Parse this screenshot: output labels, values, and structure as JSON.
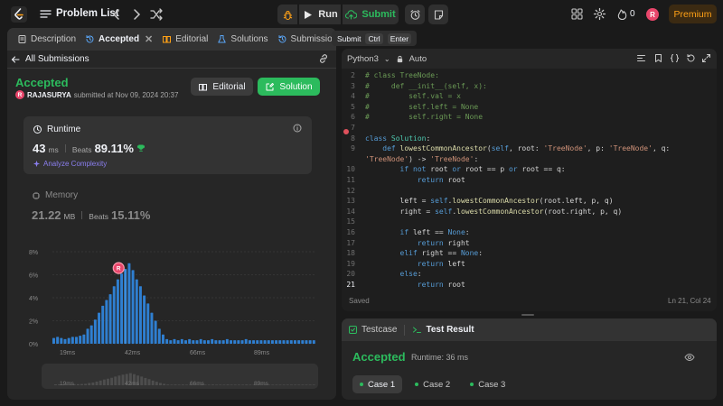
{
  "topbar": {
    "problem_list": "Problem List",
    "run": "Run",
    "submit": "Submit",
    "fire_count": "0",
    "avatar_initial": "R",
    "premium": "Premium"
  },
  "tooltip": {
    "label": "Submit",
    "key1": "Ctrl",
    "key2": "Enter"
  },
  "left_tabs": [
    {
      "label": "Description"
    },
    {
      "label": "Accepted"
    },
    {
      "label": "Editorial"
    },
    {
      "label": "Solutions"
    },
    {
      "label": "Submissions"
    }
  ],
  "submission": {
    "back_label": "All Submissions",
    "status": "Accepted",
    "avatar_initial": "R",
    "user": "RAJASURYA",
    "submitted_text": "submitted at Nov 09, 2024 20:37",
    "editorial_btn": "Editorial",
    "solution_btn": "Solution"
  },
  "runtime": {
    "title": "Runtime",
    "value": "43",
    "unit": "ms",
    "beats_label": "Beats",
    "beats": "89.11%",
    "analyze": "Analyze Complexity"
  },
  "memory": {
    "title": "Memory",
    "value": "21.22",
    "unit": "MB",
    "beats_label": "Beats",
    "beats": "15.11%"
  },
  "chart_data": {
    "type": "bar",
    "y_ticks": [
      "8%",
      "6%",
      "4%",
      "2%",
      "0%"
    ],
    "ylim": [
      0,
      8
    ],
    "x_ticks": [
      "19ms",
      "42ms",
      "66ms",
      "89ms"
    ],
    "marker_label": "R",
    "values": [
      0.5,
      0.6,
      0.5,
      0.4,
      0.5,
      0.6,
      0.6,
      0.7,
      0.8,
      1.3,
      1.6,
      2.1,
      2.7,
      3.3,
      3.8,
      4.3,
      5.0,
      5.6,
      6.1,
      6.5,
      7.0,
      6.4,
      5.6,
      5.0,
      4.2,
      3.5,
      2.7,
      2.0,
      1.3,
      0.8,
      0.4,
      0.3,
      0.4,
      0.3,
      0.4,
      0.3,
      0.4,
      0.3,
      0.3,
      0.4,
      0.3,
      0.3,
      0.4,
      0.3,
      0.3,
      0.3,
      0.4,
      0.3,
      0.3,
      0.3,
      0.3,
      0.4,
      0.3,
      0.3,
      0.3,
      0.3,
      0.3,
      0.3,
      0.3,
      0.3,
      0.3,
      0.3,
      0.3,
      0.3,
      0.3,
      0.3,
      0.3,
      0.3,
      0.3,
      0.3
    ],
    "highlight_index": 19
  },
  "editor": {
    "language": "Python3",
    "mode": "Auto",
    "saved": "Saved",
    "position": "Ln 21, Col 24",
    "lines": [
      {
        "n": "2",
        "t": "# class TreeNode:"
      },
      {
        "n": "3",
        "t": "#     def __init__(self, x):"
      },
      {
        "n": "4",
        "t": "#         self.val = x"
      },
      {
        "n": "5",
        "t": "#         self.left = None"
      },
      {
        "n": "6",
        "t": "#         self.right = None"
      },
      {
        "n": "7",
        "t": ""
      },
      {
        "n": "8",
        "t": "class Solution:"
      },
      {
        "n": "9",
        "t": "    def lowestCommonAncestor(self, root: 'TreeNode', p: 'TreeNode', q:"
      },
      {
        "n": "",
        "t": "'TreeNode') -> 'TreeNode':"
      },
      {
        "n": "10",
        "t": "        if not root or root == p or root == q:"
      },
      {
        "n": "11",
        "t": "            return root"
      },
      {
        "n": "12",
        "t": ""
      },
      {
        "n": "13",
        "t": "        left = self.lowestCommonAncestor(root.left, p, q)"
      },
      {
        "n": "14",
        "t": "        right = self.lowestCommonAncestor(root.right, p, q)"
      },
      {
        "n": "15",
        "t": ""
      },
      {
        "n": "16",
        "t": "        if left == None:"
      },
      {
        "n": "17",
        "t": "            return right"
      },
      {
        "n": "18",
        "t": "        elif right == None:"
      },
      {
        "n": "19",
        "t": "            return left"
      },
      {
        "n": "20",
        "t": "        else:"
      },
      {
        "n": "21",
        "t": "            return root"
      }
    ]
  },
  "console": {
    "tab_testcase": "Testcase",
    "tab_result": "Test Result",
    "status": "Accepted",
    "runtime": "Runtime: 36 ms",
    "cases": [
      "Case 1",
      "Case 2",
      "Case 3"
    ]
  }
}
